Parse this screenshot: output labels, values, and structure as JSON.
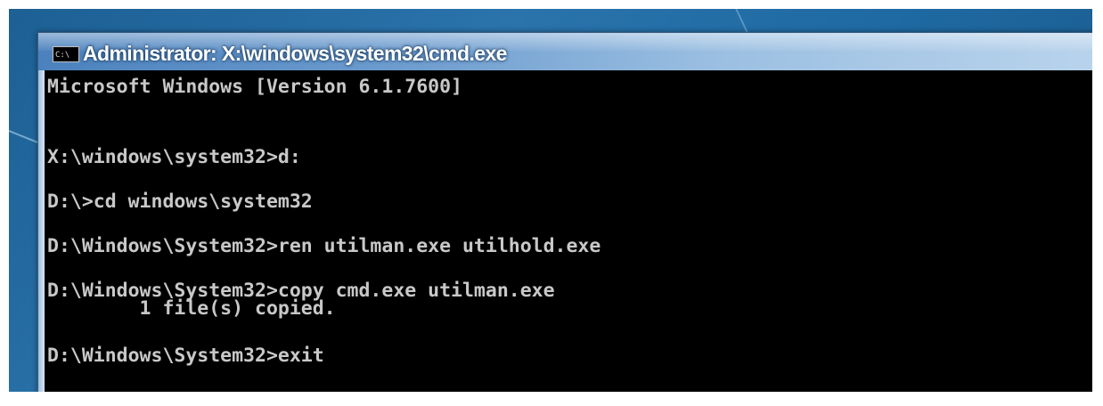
{
  "window": {
    "title": "Administrator: X:\\windows\\system32\\cmd.exe",
    "app_icon": "C:\\"
  },
  "console": {
    "lines": [
      "Microsoft Windows [Version 6.1.7600]",
      "X:\\windows\\system32>d:",
      "D:\\>cd windows\\system32",
      "D:\\Windows\\System32>ren utilman.exe utilhold.exe",
      "D:\\Windows\\System32>copy cmd.exe utilman.exe",
      "        1 file(s) copied.",
      "D:\\Windows\\System32>exit"
    ]
  }
}
